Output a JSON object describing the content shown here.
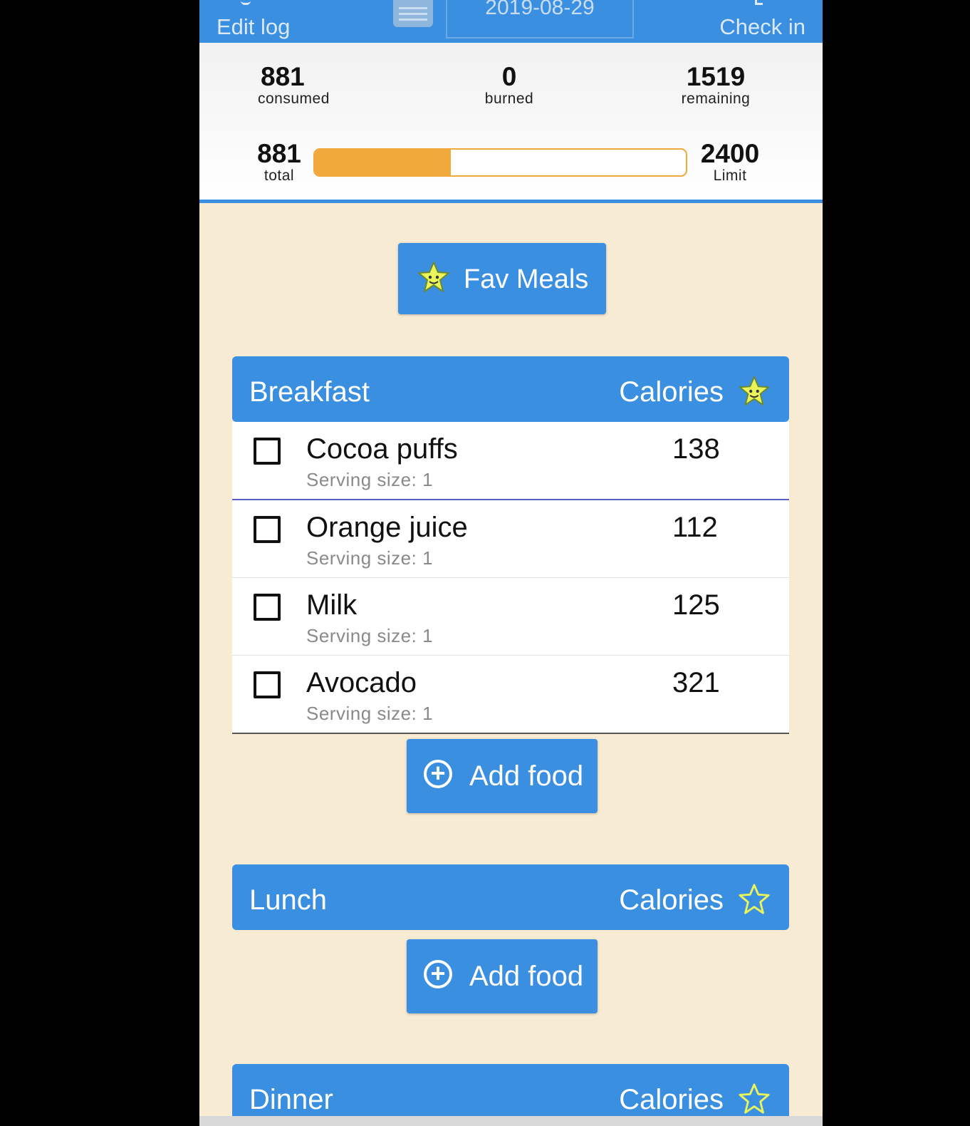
{
  "topbar": {
    "edit_label": "Edit log",
    "date": "2019-08-29",
    "checkin_label": "Check in"
  },
  "summary": {
    "consumed_value": "881",
    "consumed_label": "consumed",
    "burned_value": "0",
    "burned_label": "burned",
    "remaining_value": "1519",
    "remaining_label": "remaining",
    "total_value": "881",
    "total_label": "total",
    "limit_value": "2400",
    "limit_label": "Limit",
    "progress_fraction": 0.367
  },
  "fav_meals_label": "Fav Meals",
  "meals": {
    "breakfast": {
      "name": "Breakfast",
      "calories_label": "Calories",
      "items": [
        {
          "name": "Cocoa puffs",
          "serving": "Serving size: 1",
          "calories": "138"
        },
        {
          "name": "Orange juice",
          "serving": "Serving size: 1",
          "calories": "112"
        },
        {
          "name": "Milk",
          "serving": "Serving size: 1",
          "calories": "125"
        },
        {
          "name": "Avocado",
          "serving": "Serving size: 1",
          "calories": "321"
        }
      ],
      "add_label": "Add food"
    },
    "lunch": {
      "name": "Lunch",
      "calories_label": "Calories",
      "add_label": "Add food"
    },
    "dinner": {
      "name": "Dinner",
      "calories_label": "Calories"
    }
  },
  "colors": {
    "primary": "#3a8fe0",
    "progress": "#f0a93a",
    "background": "#f8ebd3",
    "star_filled": "#e9f55a",
    "star_outline": "#e9f55a"
  },
  "icons": {
    "edit": "pencil-icon",
    "calendar": "calendar-icon",
    "checkin": "checkin-icon",
    "fav": "smiling-star-icon",
    "add": "plus-circle-icon",
    "star_outline": "star-outline-icon"
  }
}
